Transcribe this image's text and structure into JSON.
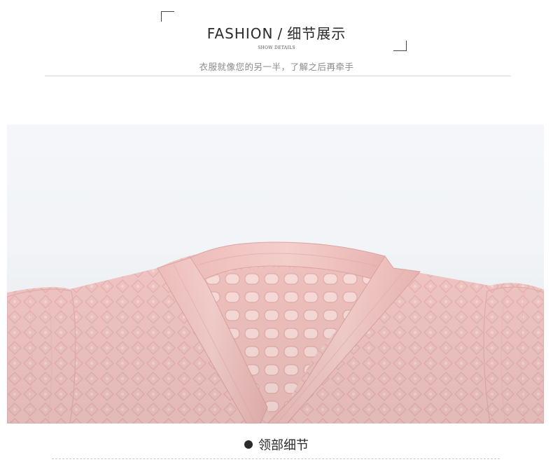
{
  "header": {
    "title_en": "FASHION",
    "separator": "/",
    "title_cn": "细节展示",
    "subtitle_en": "SHOW DETAILS",
    "tagline": "衣服就像您的另一半，了解之后再牵手"
  },
  "photo": {
    "subject": "pink knit cardigan v-neck close-up",
    "colors": {
      "background": "#eef1f5",
      "knit": "#f0c5c3",
      "knit_shadow": "#e2adab",
      "knit_light": "#f7d9d6"
    }
  },
  "caption": {
    "label": "领部细节"
  }
}
